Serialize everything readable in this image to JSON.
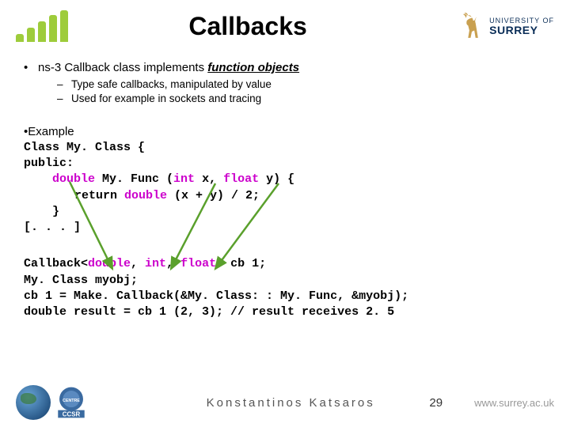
{
  "header": {
    "title": "Callbacks",
    "university": {
      "line1": "UNIVERSITY OF",
      "line2": "SURREY"
    }
  },
  "bullet1": {
    "text_prefix": "ns-3 Callback class implements ",
    "text_emph": "function objects",
    "sub1": "Type safe callbacks, manipulated by value",
    "sub2": "Used for example in sockets and tracing"
  },
  "example": {
    "label": "Example",
    "l1a": "Class My. Class {",
    "l2a": "public:",
    "l3_pre": "double",
    "l3_mid": " My. Func (",
    "l3_int": "int",
    "l3_x": " x, ",
    "l3_float": "float",
    "l3_post": " y) {",
    "l4_pre": "return ",
    "l4_dbl": "double",
    "l4_post": " (x + y) / 2;",
    "l5": "}",
    "l6": "[. . . ]"
  },
  "code2": {
    "l1_a": "Callback<",
    "l1_d": "double",
    "l1_c1": ", ",
    "l1_i": "int",
    "l1_c2": ", ",
    "l1_f": "float",
    "l1_b": "> cb 1;",
    "l2": "My. Class myobj;",
    "l3": "cb 1 = Make. Callback(&My. Class: : My. Func, &myobj);",
    "l4": "double result = cb 1 (2, 3); // result receives 2. 5"
  },
  "footer": {
    "author": "Konstantinos Katsaros",
    "page": "29",
    "url": "www.surrey.ac.uk",
    "ccsr": "CCSR"
  }
}
